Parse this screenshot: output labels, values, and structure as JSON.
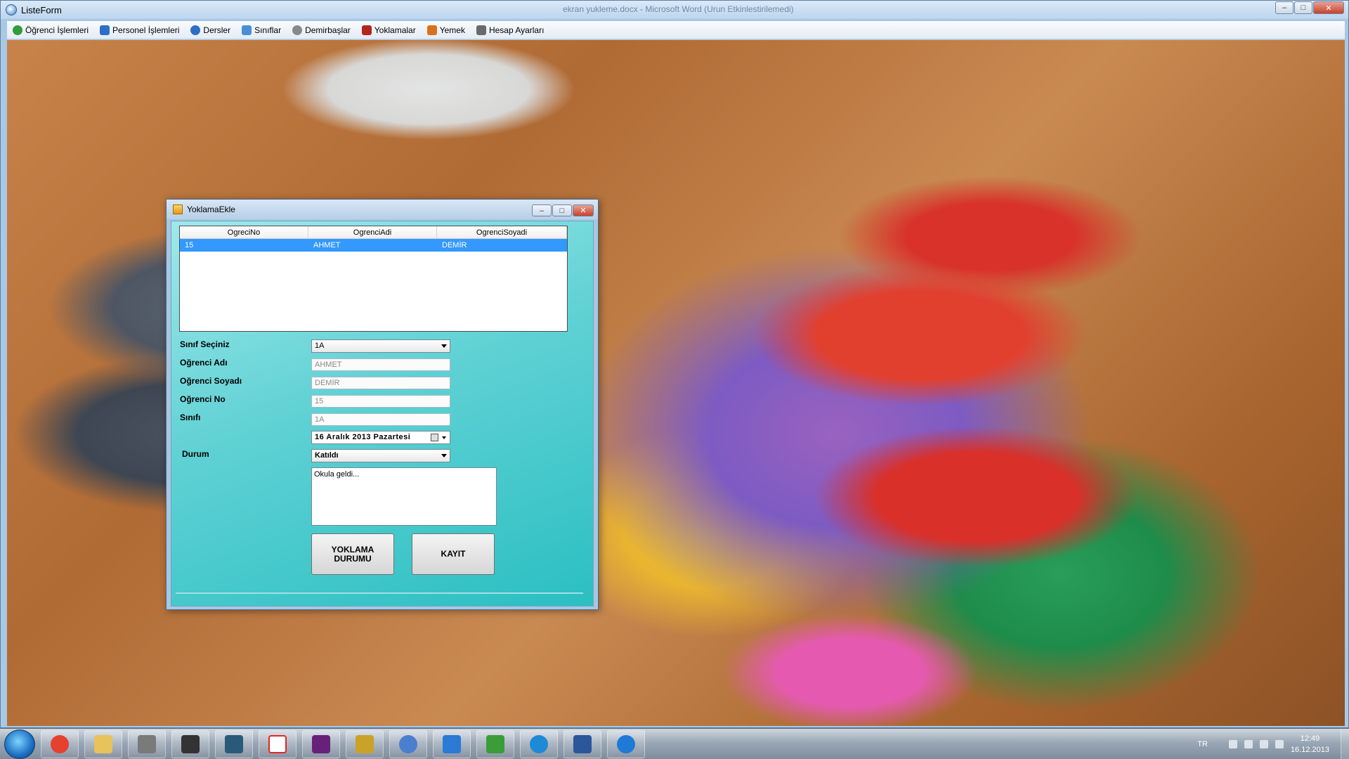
{
  "main_window": {
    "title": "ListeForm",
    "ghost_title": "ekran yukleme.docx - Microsoft Word (Urun Etkinlestirilemedi)",
    "window_buttons": {
      "minimize": "–",
      "maximize": "□",
      "close": "✕"
    }
  },
  "menu": {
    "items": [
      {
        "label": "Öğrenci İşlemleri",
        "icon": "student-check-icon",
        "color": "#2e9d3a"
      },
      {
        "label": "Personel İşlemleri",
        "icon": "personnel-arrows-icon",
        "color": "#2c6fc4"
      },
      {
        "label": "Dersler",
        "icon": "lessons-gear-icon",
        "color": "#2c6fc4"
      },
      {
        "label": "Sınıflar",
        "icon": "classes-icon",
        "color": "#4a8ed6"
      },
      {
        "label": "Demirbaşlar",
        "icon": "inventory-gear-icon",
        "color": "#888888"
      },
      {
        "label": "Yoklamalar",
        "icon": "attendance-shield-icon",
        "color": "#b3261e"
      },
      {
        "label": "Yemek",
        "icon": "meal-icon",
        "color": "#d8711a"
      },
      {
        "label": "Hesap Ayarları",
        "icon": "account-settings-icon",
        "color": "#6a6a6a"
      }
    ]
  },
  "dialog": {
    "title": "YoklamaEkle",
    "grid": {
      "columns": [
        "OgreciNo",
        "OgrenciAdi",
        "OgrenciSoyadi"
      ],
      "rows": [
        [
          "15",
          "AHMET",
          "DEMİR"
        ]
      ]
    },
    "form": {
      "sinif_label": "Sınıf Seçiniz",
      "sinif_value": "1A",
      "ad_label": "Oğrenci Adı",
      "ad_value": "AHMET",
      "soyad_label": "Oğrenci Soyadı",
      "soyad_value": "DEMİR",
      "no_label": "Oğrenci No",
      "no_value": "15",
      "sinifi_label": "Sınıfı",
      "sinifi_value": "1A",
      "date_value": "16   Aralık   2013  Pazartesi",
      "durum_label": "Durum",
      "durum_value": "Katıldı",
      "note_value": "Okula geldi..."
    },
    "buttons": {
      "yoklama_durumu": "YOKLAMA DURUMU",
      "kayit": "KAYIT"
    }
  },
  "taskbar": {
    "apps": [
      {
        "name": "chrome-icon",
        "color": "#e6402f"
      },
      {
        "name": "explorer-folder-icon",
        "color": "#e8c25a"
      },
      {
        "name": "books-icon",
        "color": "#7a7a7a"
      },
      {
        "name": "media-icon",
        "color": "#333333"
      },
      {
        "name": "game-icon",
        "color": "#2a5a7a"
      },
      {
        "name": "yandex-icon",
        "color": "#e52620"
      },
      {
        "name": "visual-studio-icon",
        "color": "#68217a"
      },
      {
        "name": "tools-icon",
        "color": "#c9a227"
      },
      {
        "name": "disk-icon",
        "color": "#4a7fd0"
      },
      {
        "name": "app-a-icon",
        "color": "#2a7ad6"
      },
      {
        "name": "transfer-arrows-icon",
        "color": "#3a9d3a"
      },
      {
        "name": "refresh-app-icon",
        "color": "#1e8ad6"
      },
      {
        "name": "word-icon",
        "color": "#2b579a"
      },
      {
        "name": "download-icon",
        "color": "#1e7ad6"
      }
    ],
    "language": "TR",
    "time": "12:49",
    "date": "16.12.2013"
  }
}
